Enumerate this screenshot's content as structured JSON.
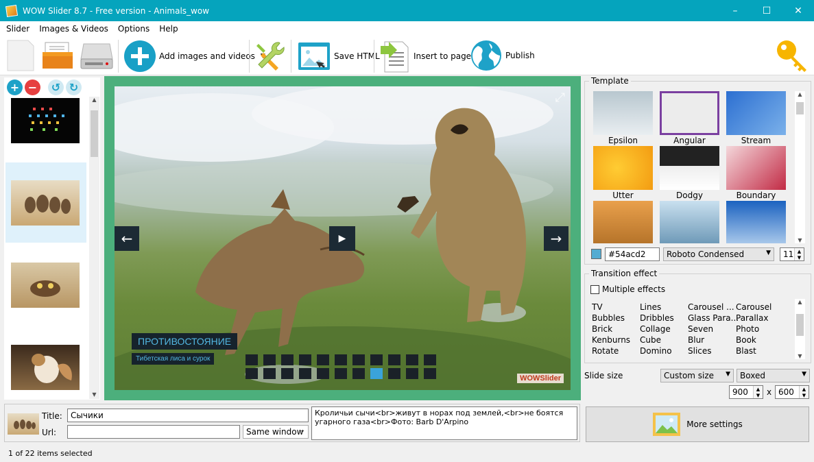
{
  "window": {
    "title": "WOW Slider 8.7 - Free version - Animals_wow",
    "minimize": "–",
    "maximize": "☐",
    "close": "✕"
  },
  "menu": [
    "Slider",
    "Images & Videos",
    "Options",
    "Help"
  ],
  "toolbar": {
    "add_label": "Add images and videos",
    "save_html_label": "Save HTML",
    "insert_label": "Insert to page",
    "publish_label": "Publish"
  },
  "left": {
    "add": "+",
    "remove": "−",
    "rotate_left": "↺",
    "rotate_right": "↻"
  },
  "slide": {
    "caption_title": "ПРОТИВОСТОЯНИЕ",
    "caption_text": "Тибетская лиса и сурок",
    "prev": "←",
    "next": "→",
    "play": "▶",
    "fullscreen": "⤢",
    "watermark": "WOWSlider",
    "bullet_count": 22,
    "active_bullet": 18
  },
  "template": {
    "group_label": "Template",
    "items": [
      "Epsilon",
      "Angular",
      "Stream",
      "Utter",
      "Dodgy",
      "Boundary",
      "",
      "",
      ""
    ],
    "color_value": "#54acd2",
    "swatch_color": "#54acd2",
    "font": "Roboto Condensed",
    "font_size": "11"
  },
  "transition": {
    "group_label": "Transition effect",
    "multiple_label": "Multiple effects",
    "columns": [
      [
        "TV",
        "Bubbles",
        "Brick",
        "Kenburns",
        "Rotate"
      ],
      [
        "Lines",
        "Dribbles",
        "Collage",
        "Cube",
        "Domino"
      ],
      [
        "Carousel ...",
        "Glass Para...",
        "Seven",
        "Blur",
        "Slices"
      ],
      [
        "Carousel",
        "Parallax",
        "Photo",
        "Book",
        "Blast"
      ]
    ]
  },
  "slide_size": {
    "label": "Slide size",
    "mode": "Custom size",
    "layout": "Boxed",
    "width": "900",
    "x": "x",
    "height": "600"
  },
  "item": {
    "title_label": "Title:",
    "title_value": "Сычики",
    "url_label": "Url:",
    "url_value": "",
    "target": "Same window",
    "description": "Кроличьи сычи<br>живут в норах под землей,<br>не боятся угарного газа<br>Фото: Barb D'Arpino"
  },
  "more_settings": "More settings",
  "status": "1 of 22 items selected"
}
